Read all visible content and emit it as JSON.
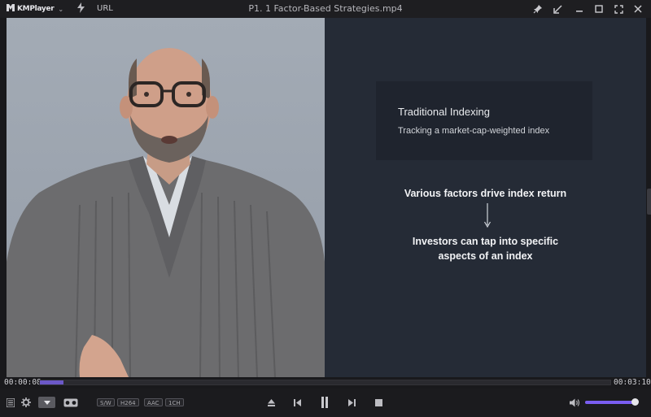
{
  "titlebar": {
    "app_name": "KMPlayer",
    "url_label": "URL",
    "file_title": "P1. 1 Factor-Based Strategies.mp4",
    "icons": [
      "kmplayer-logo-icon",
      "chevron-down-icon",
      "bolt-icon",
      "pin-icon",
      "mini-mode-icon",
      "minimize-icon",
      "maximize-icon",
      "fullscreen-icon",
      "close-icon"
    ]
  },
  "video": {
    "slide": {
      "card_title": "Traditional Indexing",
      "card_subtitle": "Tracking a market-cap-weighted index",
      "statement_1": "Various factors drive index return",
      "statement_2_line1": "Investors can tap into specific",
      "statement_2_line2": "aspects of an index"
    }
  },
  "seek": {
    "elapsed": "00:00:08",
    "total": "00:03:10",
    "progress_fraction": 0.042
  },
  "controls": {
    "badges": [
      "S/W",
      "H264",
      "AAC",
      "1CH"
    ],
    "volume_fraction": 0.95,
    "icons": [
      "playlist-icon",
      "settings-icon",
      "capture-icon",
      "vr-glasses-icon",
      "eject-icon",
      "previous-icon",
      "pause-icon",
      "next-icon",
      "stop-icon",
      "speaker-icon"
    ]
  },
  "colors": {
    "accent": "#6b58c7",
    "volume": "#7a5df0",
    "slide_bg": "#252b36",
    "card_bg": "#1f242e"
  }
}
